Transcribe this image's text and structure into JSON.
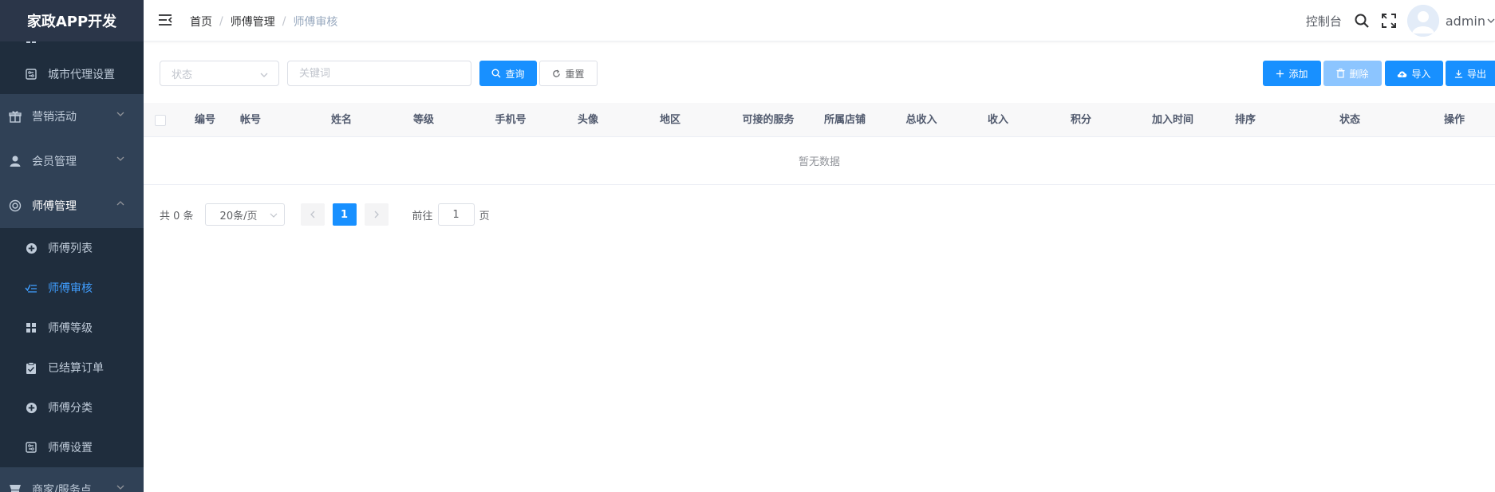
{
  "sidebar": {
    "logo": "家政APP开发",
    "items": [
      {
        "label": "城市代理设置",
        "level": "sub",
        "icon": "settings-icon"
      },
      {
        "label": "营销活动",
        "level": "top",
        "icon": "gift-icon"
      },
      {
        "label": "会员管理",
        "level": "top",
        "icon": "user-icon"
      },
      {
        "label": "师傅管理",
        "level": "top",
        "icon": "master-icon",
        "expanded": true
      },
      {
        "label": "师傅列表",
        "level": "sub",
        "icon": "plus-circle-icon"
      },
      {
        "label": "师傅审核",
        "level": "sub",
        "icon": "checklist-icon",
        "active": true
      },
      {
        "label": "师傅等级",
        "level": "sub",
        "icon": "grid-icon"
      },
      {
        "label": "已结算订单",
        "level": "sub",
        "icon": "clipboard-check-icon"
      },
      {
        "label": "师傅分类",
        "level": "sub",
        "icon": "plus-circle-icon"
      },
      {
        "label": "师傅设置",
        "level": "sub",
        "icon": "settings-icon"
      },
      {
        "label": "商家/服务点",
        "level": "top",
        "icon": "shop-icon"
      }
    ]
  },
  "navbar": {
    "breadcrumb": [
      "首页",
      "师傅管理",
      "师傅审核"
    ],
    "dashboard": "控制台",
    "username": "admin"
  },
  "filters": {
    "status_placeholder": "状态",
    "keyword_placeholder": "关键词",
    "query_label": "查询",
    "reset_label": "重置"
  },
  "actions": {
    "add_label": "添加",
    "delete_label": "删除",
    "import_label": "导入",
    "export_label": "导出"
  },
  "table": {
    "columns": [
      "编号",
      "帐号",
      "姓名",
      "等级",
      "手机号",
      "头像",
      "地区",
      "可接的服务",
      "所属店铺",
      "总收入",
      "收入",
      "积分",
      "加入时间",
      "排序",
      "状态",
      "操作"
    ],
    "empty_text": "暂无数据"
  },
  "pagination": {
    "total_text": "共 0 条",
    "page_size": "20条/页",
    "current_page": "1",
    "goto_prefix": "前往",
    "goto_value": "1",
    "goto_suffix": "页"
  },
  "colors": {
    "sidebar_bg": "#304156",
    "submenu_bg": "#1f2d3d",
    "primary": "#1890ff",
    "active_text": "#409eff"
  }
}
